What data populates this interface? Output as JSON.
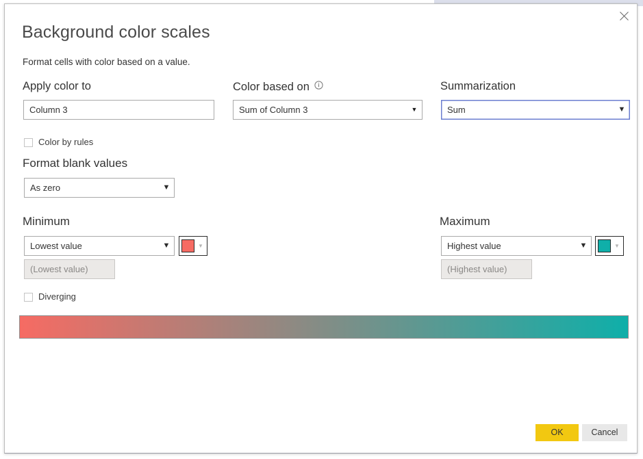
{
  "dialog": {
    "title": "Background color scales",
    "subtitle": "Format cells with color based on a value.",
    "close_icon": "close-icon"
  },
  "apply_color_to": {
    "label": "Apply color to",
    "value": "Column 3"
  },
  "color_based_on": {
    "label": "Color based on",
    "info_icon": "info-circle-icon",
    "value": "Sum of Column 3"
  },
  "summarization": {
    "label": "Summarization",
    "value": "Sum",
    "focus_color": "#6b7ed0"
  },
  "color_by_rules": {
    "label": "Color by rules",
    "checked": false
  },
  "format_blank_values": {
    "label": "Format blank values",
    "value": "As zero"
  },
  "minimum": {
    "label": "Minimum",
    "value": "Lowest value",
    "field_placeholder": "(Lowest value)",
    "color": "#F66B63"
  },
  "maximum": {
    "label": "Maximum",
    "value": "Highest value",
    "field_placeholder": "(Highest value)",
    "color": "#0FAFA9"
  },
  "diverging": {
    "label": "Diverging",
    "checked": false
  },
  "gradient_preview": {
    "start_color": "#F66B63",
    "end_color": "#0FAFA9"
  },
  "footer": {
    "ok_label": "OK",
    "cancel_label": "Cancel",
    "ok_color": "#f2c811",
    "cancel_color": "#e8e8e8"
  }
}
